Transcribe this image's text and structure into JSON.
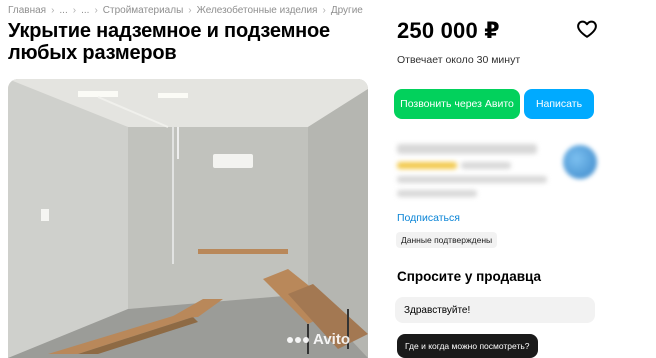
{
  "breadcrumb": [
    "Главная",
    "...",
    "...",
    "Стройматериалы",
    "Железобетонные изделия",
    "Другие"
  ],
  "listing": {
    "title_line1": "Укрытие надземное и подземное",
    "title_line2": "любых размеров",
    "price": "250 000 ₽",
    "reply_time": "Отвечает около 30 минут"
  },
  "actions": {
    "call_label": "Позвонить через Авито",
    "write_label": "Написать"
  },
  "seller": {
    "subscribe_label": "Подписаться",
    "verified_badge": "Данные подтверждены"
  },
  "ask": {
    "title": "Спросите у продавца",
    "message_value": "Здравствуйте!",
    "quick_question": "Где и когда можно посмотреть?"
  },
  "gallery": {
    "watermark": "Avito"
  },
  "colors": {
    "call_button": "#02d15c",
    "write_button": "#00aaff",
    "link": "#0a84d6"
  },
  "icons": {
    "favorite": "heart-icon"
  }
}
